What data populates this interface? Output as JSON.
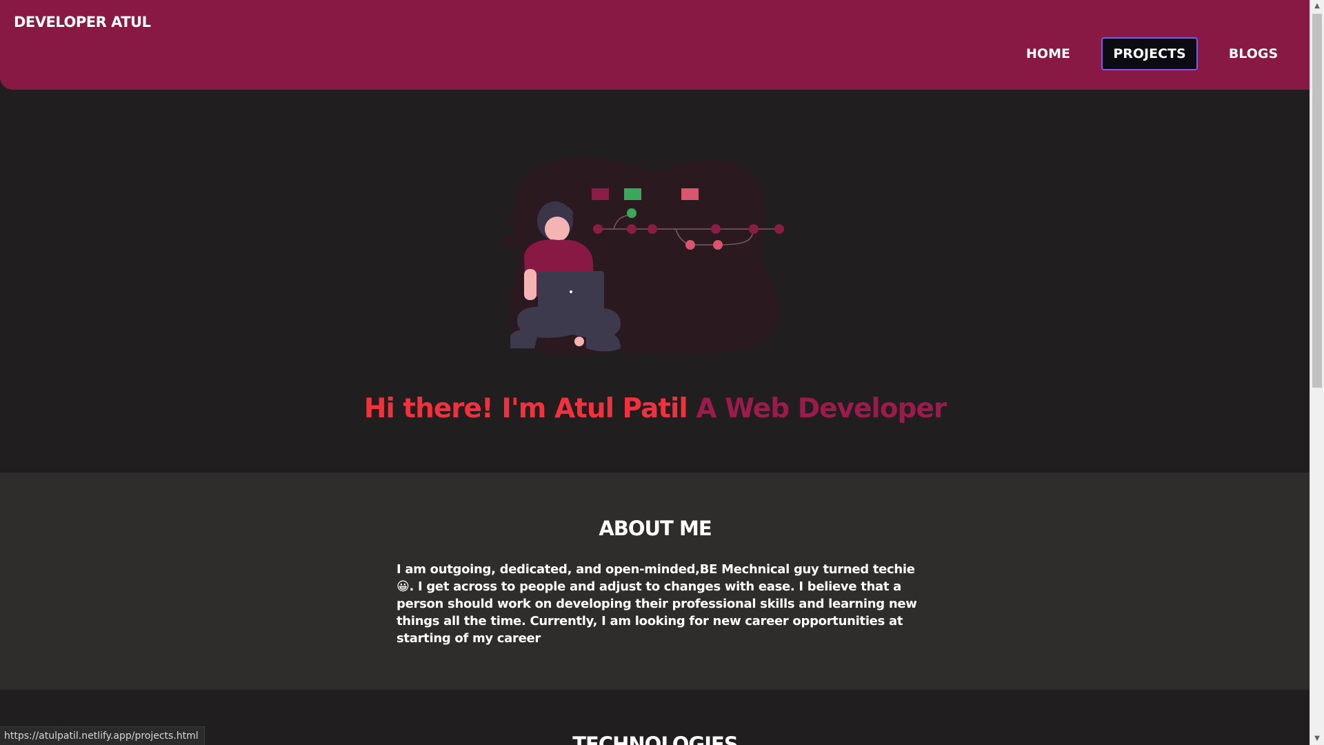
{
  "header": {
    "brand": "DEVELOPER ATUL",
    "nav": [
      {
        "label": "HOME"
      },
      {
        "label": "PROJECTS"
      },
      {
        "label": "BLOGS"
      }
    ]
  },
  "hero": {
    "greeting": "Hi there! I'm Atul Patil",
    "role": "A Web Developer"
  },
  "about": {
    "title": "ABOUT ME",
    "text": "I am outgoing, dedicated, and open-minded,BE Mechnical guy turned techie😀. I get across to people and adjust to changes with ease. I believe that a person should work on developing their professional skills and learning new things all the time. Currently, I am looking for new career opportunities at starting of my career"
  },
  "technologies": {
    "title": "TECHNOLOGIES"
  },
  "status_bar": {
    "url": "https://atulpatil.netlify.app/projects.html"
  },
  "colors": {
    "header_bg": "#871944",
    "page_bg": "#201e1e",
    "section_bg": "#2e2d2c",
    "accent_red": "#f2313f",
    "accent_maroon": "#9b1b4c"
  }
}
